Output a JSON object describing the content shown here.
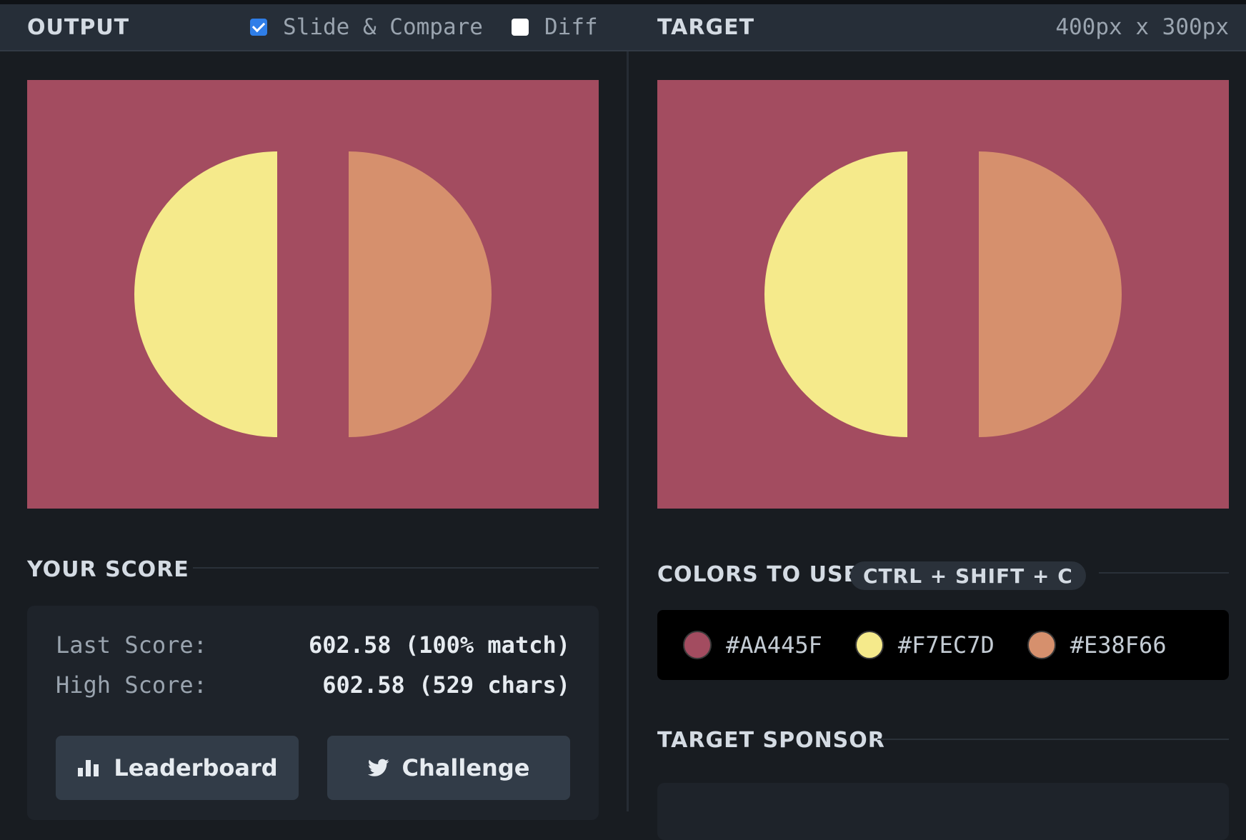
{
  "header": {
    "output_title": "OUTPUT",
    "slide_compare_label": "Slide & Compare",
    "slide_compare_checked": true,
    "diff_label": "Diff",
    "diff_checked": false,
    "target_title": "TARGET",
    "dimensions": "400px x 300px"
  },
  "score": {
    "section_title": "YOUR SCORE",
    "last_label": "Last Score:",
    "last_value": "602.58 (100% match)",
    "high_label": "High Score:",
    "high_value": "602.58 (529 chars)",
    "leaderboard_label": "Leaderboard",
    "challenge_label": "Challenge"
  },
  "colors": {
    "section_title": "COLORS TO USE",
    "shortcut": "CTRL + SHIFT + C",
    "items": [
      {
        "hex": "#AA445F"
      },
      {
        "hex": "#F7EC7D"
      },
      {
        "hex": "#E38F66"
      }
    ]
  },
  "sponsor": {
    "section_title": "TARGET SPONSOR"
  },
  "icons": {
    "leaderboard": "bar-chart-icon",
    "challenge": "twitter-icon"
  }
}
